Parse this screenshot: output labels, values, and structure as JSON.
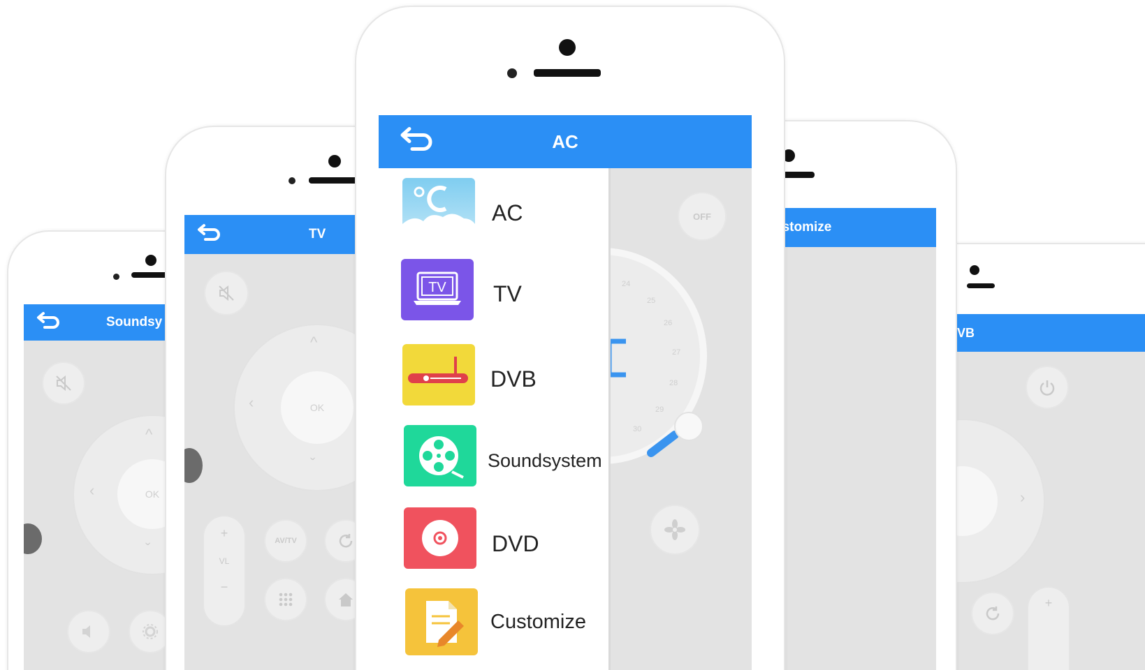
{
  "left_phone": {
    "title": "Soundsy",
    "back_icon": "back-arrow-icon",
    "ok_label": "OK",
    "colors": {
      "bar": "#2b8ff5",
      "screen": "#e3e3e3"
    }
  },
  "tv_phone": {
    "title": "TV",
    "ok_label": "OK",
    "vol_plus": "+",
    "vol_label": "VL",
    "vol_minus": "−",
    "avtv_label": "AV/TV"
  },
  "center_phone": {
    "title": "AC",
    "behind": {
      "off_label": "OFF",
      "unit": "°C",
      "dial_ticks": [
        "24",
        "25",
        "26",
        "27",
        "28",
        "29",
        "30"
      ]
    },
    "menu": [
      {
        "label": "AC",
        "icon": "ac-cloud-icon",
        "color": "#8fd3f1"
      },
      {
        "label": "TV",
        "icon": "tv-icon",
        "color": "#7b55e8"
      },
      {
        "label": "DVB",
        "icon": "dvb-box-icon",
        "color": "#f2d93a"
      },
      {
        "label": "Soundsystem",
        "icon": "film-reel-icon",
        "color": "#1fd89a"
      },
      {
        "label": "DVD",
        "icon": "disc-icon",
        "color": "#f0525e"
      },
      {
        "label": "Customize",
        "icon": "note-pencil-icon",
        "color": "#f5c33b"
      }
    ]
  },
  "customize_phone": {
    "title": "ustomize"
  },
  "right_phone": {
    "title": "VB",
    "plus": "+"
  }
}
